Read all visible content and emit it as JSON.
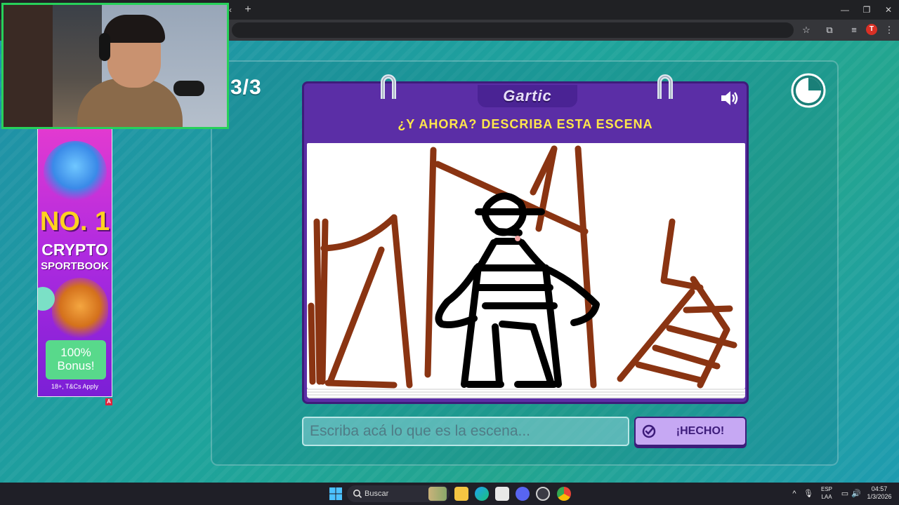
{
  "browser": {
    "new_tab": "+",
    "tab_scroll": "‹",
    "window_controls": {
      "minimize": "—",
      "maximize": "❐",
      "close": "✕"
    },
    "toolbar_icons": {
      "bookmark": "☆",
      "extensions": "⧉",
      "media": "≡",
      "menu": "⋮"
    },
    "profile_initial": "T"
  },
  "game": {
    "round": "3/3",
    "logo": "Gartic",
    "prompt": "¿Y AHORA? DESCRIBA ESTA ESCENA",
    "input_placeholder": "Escriba acá lo que es la escena...",
    "done_label": "¡HECHO!",
    "colors": {
      "board": "#5b2ea6",
      "prompt": "#ffe74a",
      "button": "#c6a8f3"
    }
  },
  "ad": {
    "headline": "NO. 1",
    "line1": "CRYPTO",
    "line2": "SPORTBOOK",
    "bonus_line1": "100%",
    "bonus_line2": "Bonus!",
    "disclaimer": "18+, T&Cs Apply",
    "choices_badge": "A"
  },
  "taskbar": {
    "search_label": "Buscar",
    "lang_line1": "ESP",
    "lang_line2": "LAA",
    "time": "04:57",
    "date": "1/3/2026",
    "tray_icons": {
      "chevron": "^",
      "mic": "🎙",
      "display": "▭",
      "volume": "🔊"
    }
  }
}
